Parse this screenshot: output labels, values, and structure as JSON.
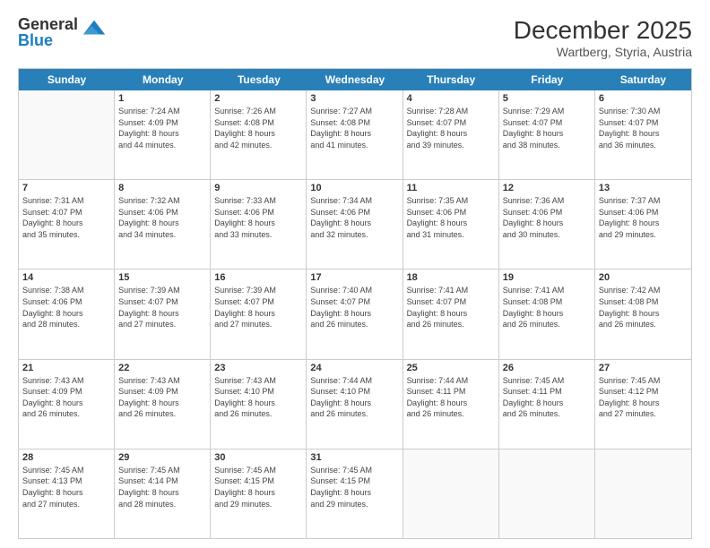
{
  "header": {
    "logo_general": "General",
    "logo_blue": "Blue",
    "title": "December 2025",
    "subtitle": "Wartberg, Styria, Austria"
  },
  "days_of_week": [
    "Sunday",
    "Monday",
    "Tuesday",
    "Wednesday",
    "Thursday",
    "Friday",
    "Saturday"
  ],
  "weeks": [
    [
      {
        "day": "",
        "info": ""
      },
      {
        "day": "1",
        "info": "Sunrise: 7:24 AM\nSunset: 4:09 PM\nDaylight: 8 hours\nand 44 minutes."
      },
      {
        "day": "2",
        "info": "Sunrise: 7:26 AM\nSunset: 4:08 PM\nDaylight: 8 hours\nand 42 minutes."
      },
      {
        "day": "3",
        "info": "Sunrise: 7:27 AM\nSunset: 4:08 PM\nDaylight: 8 hours\nand 41 minutes."
      },
      {
        "day": "4",
        "info": "Sunrise: 7:28 AM\nSunset: 4:07 PM\nDaylight: 8 hours\nand 39 minutes."
      },
      {
        "day": "5",
        "info": "Sunrise: 7:29 AM\nSunset: 4:07 PM\nDaylight: 8 hours\nand 38 minutes."
      },
      {
        "day": "6",
        "info": "Sunrise: 7:30 AM\nSunset: 4:07 PM\nDaylight: 8 hours\nand 36 minutes."
      }
    ],
    [
      {
        "day": "7",
        "info": "Sunrise: 7:31 AM\nSunset: 4:07 PM\nDaylight: 8 hours\nand 35 minutes."
      },
      {
        "day": "8",
        "info": "Sunrise: 7:32 AM\nSunset: 4:06 PM\nDaylight: 8 hours\nand 34 minutes."
      },
      {
        "day": "9",
        "info": "Sunrise: 7:33 AM\nSunset: 4:06 PM\nDaylight: 8 hours\nand 33 minutes."
      },
      {
        "day": "10",
        "info": "Sunrise: 7:34 AM\nSunset: 4:06 PM\nDaylight: 8 hours\nand 32 minutes."
      },
      {
        "day": "11",
        "info": "Sunrise: 7:35 AM\nSunset: 4:06 PM\nDaylight: 8 hours\nand 31 minutes."
      },
      {
        "day": "12",
        "info": "Sunrise: 7:36 AM\nSunset: 4:06 PM\nDaylight: 8 hours\nand 30 minutes."
      },
      {
        "day": "13",
        "info": "Sunrise: 7:37 AM\nSunset: 4:06 PM\nDaylight: 8 hours\nand 29 minutes."
      }
    ],
    [
      {
        "day": "14",
        "info": "Sunrise: 7:38 AM\nSunset: 4:06 PM\nDaylight: 8 hours\nand 28 minutes."
      },
      {
        "day": "15",
        "info": "Sunrise: 7:39 AM\nSunset: 4:07 PM\nDaylight: 8 hours\nand 27 minutes."
      },
      {
        "day": "16",
        "info": "Sunrise: 7:39 AM\nSunset: 4:07 PM\nDaylight: 8 hours\nand 27 minutes."
      },
      {
        "day": "17",
        "info": "Sunrise: 7:40 AM\nSunset: 4:07 PM\nDaylight: 8 hours\nand 26 minutes."
      },
      {
        "day": "18",
        "info": "Sunrise: 7:41 AM\nSunset: 4:07 PM\nDaylight: 8 hours\nand 26 minutes."
      },
      {
        "day": "19",
        "info": "Sunrise: 7:41 AM\nSunset: 4:08 PM\nDaylight: 8 hours\nand 26 minutes."
      },
      {
        "day": "20",
        "info": "Sunrise: 7:42 AM\nSunset: 4:08 PM\nDaylight: 8 hours\nand 26 minutes."
      }
    ],
    [
      {
        "day": "21",
        "info": "Sunrise: 7:43 AM\nSunset: 4:09 PM\nDaylight: 8 hours\nand 26 minutes."
      },
      {
        "day": "22",
        "info": "Sunrise: 7:43 AM\nSunset: 4:09 PM\nDaylight: 8 hours\nand 26 minutes."
      },
      {
        "day": "23",
        "info": "Sunrise: 7:43 AM\nSunset: 4:10 PM\nDaylight: 8 hours\nand 26 minutes."
      },
      {
        "day": "24",
        "info": "Sunrise: 7:44 AM\nSunset: 4:10 PM\nDaylight: 8 hours\nand 26 minutes."
      },
      {
        "day": "25",
        "info": "Sunrise: 7:44 AM\nSunset: 4:11 PM\nDaylight: 8 hours\nand 26 minutes."
      },
      {
        "day": "26",
        "info": "Sunrise: 7:45 AM\nSunset: 4:11 PM\nDaylight: 8 hours\nand 26 minutes."
      },
      {
        "day": "27",
        "info": "Sunrise: 7:45 AM\nSunset: 4:12 PM\nDaylight: 8 hours\nand 27 minutes."
      }
    ],
    [
      {
        "day": "28",
        "info": "Sunrise: 7:45 AM\nSunset: 4:13 PM\nDaylight: 8 hours\nand 27 minutes."
      },
      {
        "day": "29",
        "info": "Sunrise: 7:45 AM\nSunset: 4:14 PM\nDaylight: 8 hours\nand 28 minutes."
      },
      {
        "day": "30",
        "info": "Sunrise: 7:45 AM\nSunset: 4:15 PM\nDaylight: 8 hours\nand 29 minutes."
      },
      {
        "day": "31",
        "info": "Sunrise: 7:45 AM\nSunset: 4:15 PM\nDaylight: 8 hours\nand 29 minutes."
      },
      {
        "day": "",
        "info": ""
      },
      {
        "day": "",
        "info": ""
      },
      {
        "day": "",
        "info": ""
      }
    ]
  ]
}
